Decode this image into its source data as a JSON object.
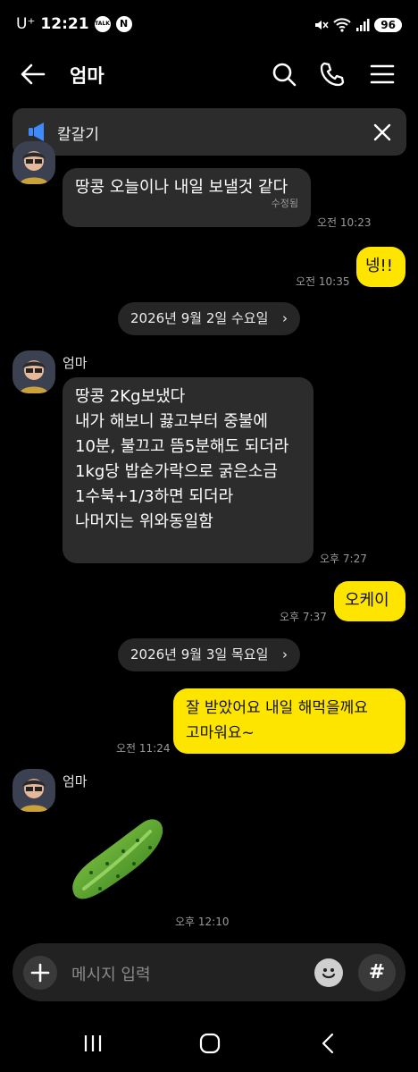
{
  "status_bar": {
    "carrier": "U⁺",
    "time": "12:21",
    "badges": [
      "TALK",
      "N"
    ],
    "battery": "96"
  },
  "header": {
    "title": "엄마",
    "icons": [
      "back-arrow-icon",
      "search-icon",
      "phone-icon",
      "menu-icon"
    ]
  },
  "notice": {
    "label": "칼갈기"
  },
  "messages": [
    {
      "sender": "엄마",
      "text": "땅콩 오늘이나 내일 보낼것 같다",
      "edited": "수정됨",
      "time": "오전 10:23"
    },
    {
      "sender": "me",
      "text": "넹!!",
      "time": "오전 10:35"
    },
    {
      "date": "2026년 9월 2일 수요일"
    },
    {
      "sender": "엄마",
      "name": "엄마",
      "lines": [
        "땅콩 2Kg보냈다",
        "내가 해보니 끓고부터 중불에",
        "10분, 불끄고 뜸5분해도 되더라",
        "1kg당 밥숟가락으로 굵은소금",
        "1수북+1/3하면 되더라",
        "나머지는 위와동일함"
      ],
      "time": "오후 7:27"
    },
    {
      "sender": "me",
      "text": "오케이",
      "time": "오후 7:37"
    },
    {
      "date": "2026년 9월 3일 목요일"
    },
    {
      "sender": "me",
      "lines": [
        "잘 받았어요 내일 해먹을께요",
        "고마워요~"
      ],
      "time": "오전 11:24"
    },
    {
      "sender": "엄마",
      "name": "엄마",
      "emoticon": "cucumber",
      "time": "오후 12:10"
    }
  ],
  "input": {
    "placeholder": "메시지 입력",
    "icons": [
      "plus-icon",
      "emoji-icon",
      "hash-icon"
    ],
    "hash_label": "#"
  },
  "colors": {
    "background": "#000000",
    "incoming_bubble": "#2c2c2c",
    "outgoing_bubble": "#fee500",
    "notice_bg": "#2c2c2c"
  }
}
